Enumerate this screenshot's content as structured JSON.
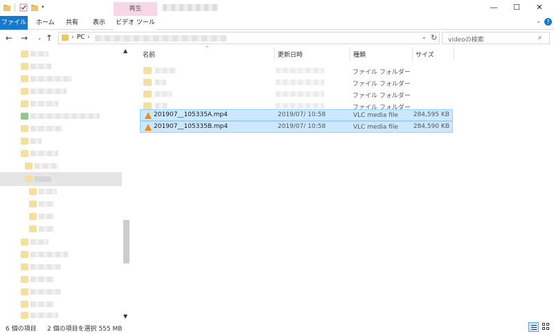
{
  "titlebar": {
    "context_tab_title": "再生",
    "window_controls": [
      "minimize-icon",
      "maximize-icon",
      "close-icon"
    ]
  },
  "ribbon": {
    "tabs": [
      {
        "label": "ファイル"
      },
      {
        "label": "ホーム"
      },
      {
        "label": "共有"
      },
      {
        "label": "表示"
      },
      {
        "label": "ビデオ ツール"
      }
    ],
    "accent": "#1979ca",
    "context_color": "#f7d6e6"
  },
  "address": {
    "pc_label": "PC",
    "search_placeholder": "videoの検索"
  },
  "columns": {
    "name": "名前",
    "date": "更新日時",
    "type": "種類",
    "size": "サイズ"
  },
  "files": {
    "folders": [
      {
        "type": "ファイル フォルダー"
      },
      {
        "type": "ファイル フォルダー"
      },
      {
        "type": "ファイル フォルダー"
      },
      {
        "type": "ファイル フォルダー"
      }
    ],
    "videos": [
      {
        "name": "201907__105335A.mp4",
        "date": "2019/07/ 10:58",
        "type": "VLC media file",
        "size": "284,595 KB"
      },
      {
        "name": "201907__105335B.mp4",
        "date": "2019/07/ 10:58",
        "type": "VLC media file",
        "size": "284,590 KB"
      }
    ],
    "selection_color": "#cce8ff"
  },
  "status": {
    "item_count": "6 個の項目",
    "selection": "2 個の項目を選択  555 MB"
  }
}
